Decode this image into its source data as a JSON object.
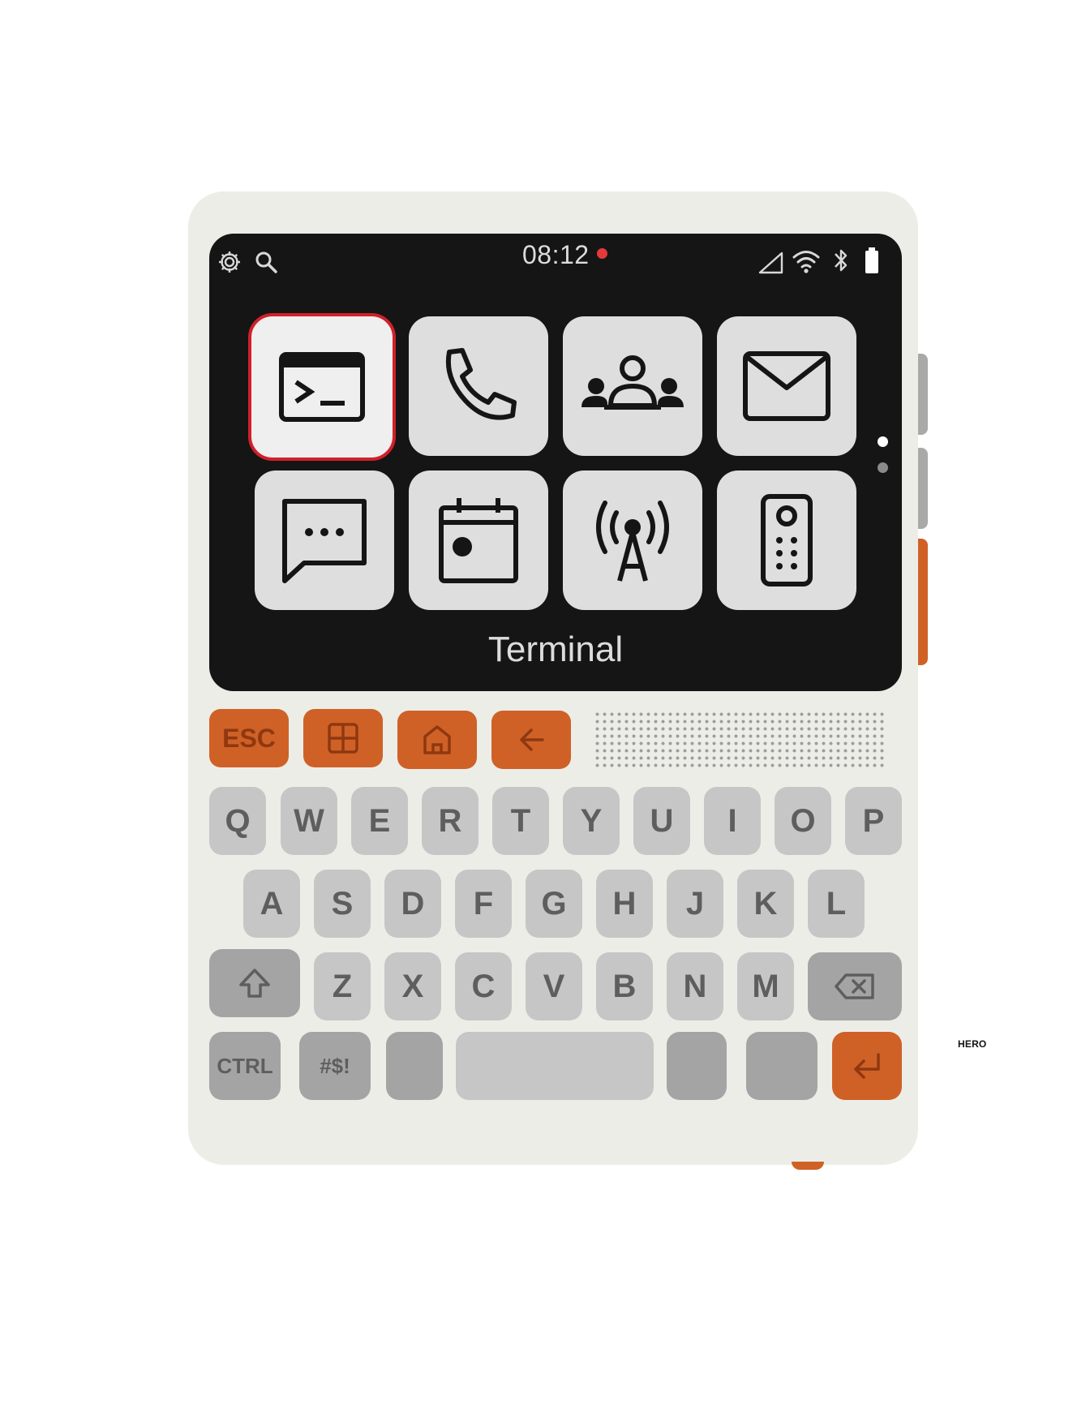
{
  "status_bar": {
    "time": "08:12",
    "recording_indicator_color": "#e53a3a",
    "left_icons": [
      "settings-icon",
      "search-icon"
    ],
    "right_icons": [
      "cellular-signal-icon",
      "wifi-icon",
      "bluetooth-icon",
      "battery-icon"
    ]
  },
  "launcher": {
    "apps": [
      {
        "icon": "terminal-icon",
        "selected": true
      },
      {
        "icon": "phone-icon"
      },
      {
        "icon": "contacts-icon"
      },
      {
        "icon": "mail-icon"
      },
      {
        "icon": "messages-icon"
      },
      {
        "icon": "calendar-icon"
      },
      {
        "icon": "radio-tower-icon"
      },
      {
        "icon": "remote-control-icon"
      }
    ],
    "selected_app_name": "Terminal",
    "page_indicator": {
      "pages": 2,
      "current": 1
    }
  },
  "function_keys": {
    "esc_label": "ESC",
    "icons": [
      "grid-icon",
      "home-icon",
      "back-arrow-icon"
    ]
  },
  "keyboard": {
    "row1": [
      "Q",
      "W",
      "E",
      "R",
      "T",
      "Y",
      "U",
      "I",
      "O",
      "P"
    ],
    "row2": [
      "A",
      "S",
      "D",
      "F",
      "G",
      "H",
      "J",
      "K",
      "L"
    ],
    "row3": [
      "Z",
      "X",
      "C",
      "V",
      "B",
      "N",
      "M"
    ],
    "ctrl_label": "CTRL",
    "symbols_label": "#$!",
    "special_icons": [
      "shift-icon",
      "backspace-icon",
      "enter-icon"
    ]
  },
  "colors": {
    "accent": "#cf6127",
    "selection": "#d0202a",
    "screen_bg": "#151515",
    "device_body": "#edede8"
  },
  "side_label": "HERO"
}
